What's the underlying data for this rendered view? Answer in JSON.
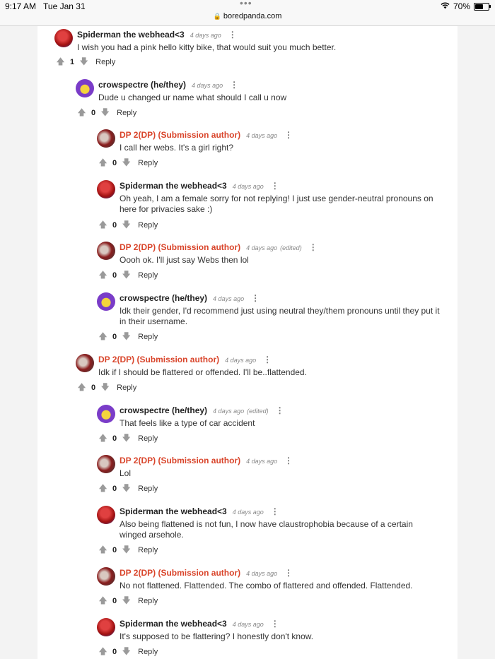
{
  "status_bar": {
    "time": "9:17 AM",
    "date": "Tue Jan 31",
    "url": "boredpanda.com",
    "battery": "70%",
    "battery_fill": 0.7
  },
  "comments": [
    {
      "author": "Spiderman the webhead<3",
      "op": false,
      "time": "4 days ago",
      "edited": "",
      "text": "I wish you had a pink hello kitty bike, that would suit you much better.",
      "votes": "1",
      "reply": "Reply",
      "avatar": "spiderman"
    },
    {
      "author": "crowspectre (he/they)",
      "op": false,
      "time": "4 days ago",
      "edited": "",
      "text": "Dude u changed ur name what should I call u now",
      "votes": "0",
      "reply": "Reply",
      "avatar": "crow"
    },
    {
      "author": "DP 2(DP) (Submission author)",
      "op": true,
      "time": "4 days ago",
      "edited": "",
      "text": "I call her webs. It's a girl right?",
      "votes": "0",
      "reply": "Reply",
      "avatar": "dp"
    },
    {
      "author": "Spiderman the webhead<3",
      "op": false,
      "time": "4 days ago",
      "edited": "",
      "text": "Oh yeah, I am a female sorry for not replying! I just use gender-neutral pronouns on here for privacies sake :)",
      "votes": "0",
      "reply": "Reply",
      "avatar": "spiderman"
    },
    {
      "author": "DP 2(DP) (Submission author)",
      "op": true,
      "time": "4 days ago",
      "edited": "(edited)",
      "text": "Oooh ok. I'll just say Webs then lol",
      "votes": "0",
      "reply": "Reply",
      "avatar": "dp"
    },
    {
      "author": "crowspectre (he/they)",
      "op": false,
      "time": "4 days ago",
      "edited": "",
      "text": "Idk their gender, I'd recommend just using neutral they/them pronouns until they put it in their username.",
      "votes": "0",
      "reply": "Reply",
      "avatar": "crow"
    },
    {
      "author": "DP 2(DP) (Submission author)",
      "op": true,
      "time": "4 days ago",
      "edited": "",
      "text": "Idk if I should be flattered or offended. I'll be..flattended.",
      "votes": "0",
      "reply": "Reply",
      "avatar": "dp"
    },
    {
      "author": "crowspectre (he/they)",
      "op": false,
      "time": "4 days ago",
      "edited": "(edited)",
      "text": "That feels like a type of car accident",
      "votes": "0",
      "reply": "Reply",
      "avatar": "crow"
    },
    {
      "author": "DP 2(DP) (Submission author)",
      "op": true,
      "time": "4 days ago",
      "edited": "",
      "text": "Lol",
      "votes": "0",
      "reply": "Reply",
      "avatar": "dp"
    },
    {
      "author": "Spiderman the webhead<3",
      "op": false,
      "time": "4 days ago",
      "edited": "",
      "text": "Also being flattened is not fun, I now have claustrophobia because of a certain winged arsehole.",
      "votes": "0",
      "reply": "Reply",
      "avatar": "spiderman"
    },
    {
      "author": "DP 2(DP) (Submission author)",
      "op": true,
      "time": "4 days ago",
      "edited": "",
      "text": "No not flattened. Flattended. The combo of flattered and offended. Flattended.",
      "votes": "0",
      "reply": "Reply",
      "avatar": "dp"
    },
    {
      "author": "Spiderman the webhead<3",
      "op": false,
      "time": "4 days ago",
      "edited": "",
      "text": "It's supposed to be flattering? I honestly don't know.",
      "votes": "0",
      "reply": "Reply",
      "avatar": "spiderman"
    }
  ]
}
